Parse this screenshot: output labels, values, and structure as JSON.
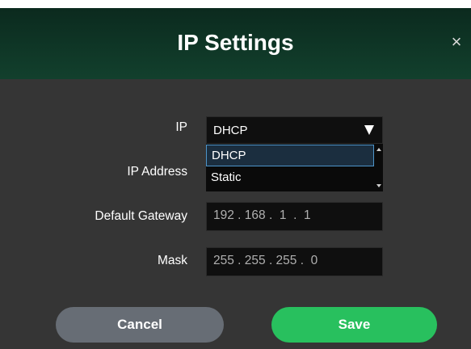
{
  "dialog": {
    "title": "IP Settings",
    "close_symbol": "×"
  },
  "form": {
    "ip_mode": {
      "label": "IP",
      "value": "DHCP",
      "options": [
        "DHCP",
        "Static"
      ],
      "highlighted_option": "DHCP"
    },
    "ip_address": {
      "label": "IP Address"
    },
    "default_gateway": {
      "label": "Default Gateway",
      "value": "192 . 168 .  1  .  1"
    },
    "mask": {
      "label": "Mask",
      "value": "255 . 255 . 255 .  0"
    }
  },
  "buttons": {
    "cancel": "Cancel",
    "save": "Save"
  },
  "colors": {
    "header": "#12402d",
    "panel": "#353535",
    "cancel_button": "#676d75",
    "save_button": "#28c05e",
    "dropdown_highlight_border": "#4d94c9"
  },
  "icons": {
    "close": "close-icon",
    "dropdown_caret": "caret-down-icon"
  }
}
